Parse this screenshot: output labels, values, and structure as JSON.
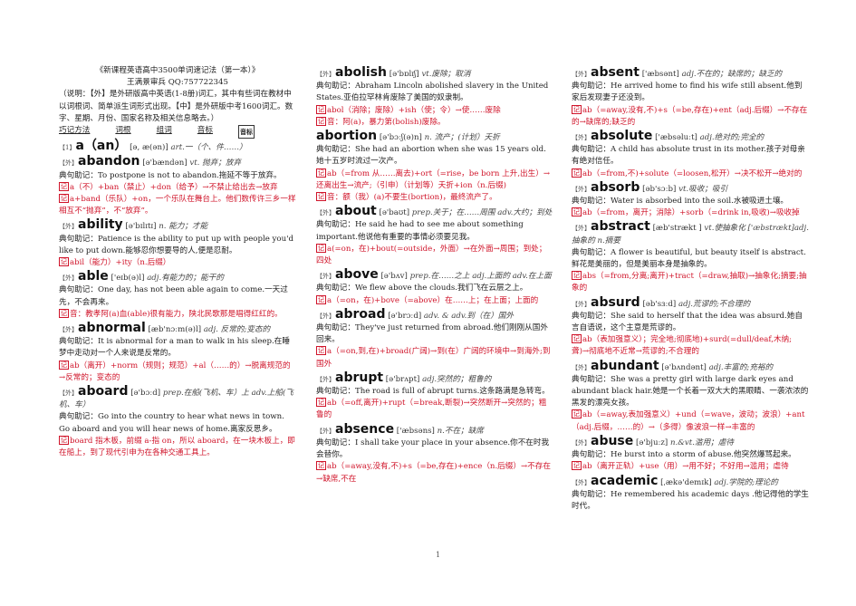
{
  "header": {
    "title": "《新课程英语高中3500单词速记法（第一本）》",
    "author": "王满景审兵 QQ:757722345",
    "note": "（说明：【外】是外研版高中英语(1-8册)词汇，其中有些词在教材中以词根词、简单派生词形式出现。【中】是外研版中考1600词汇。数字、星期、月份、国家名称及相关信息略去。）"
  },
  "legend": [
    "巧记方法",
    "词根",
    "组词",
    "音标"
  ],
  "legend_box": "音标",
  "columns": [
    {
      "entries": [
        {
          "num": "【1】",
          "word": "a（an）",
          "phon": "[ə, æ(ən)]",
          "pos": "art.一（个、件……）",
          "lines": []
        },
        {
          "num": "【外】",
          "word": "abandon",
          "phon": "[ə'bændən]",
          "pos": "vt. 抛弃；放弃",
          "lines": [
            "典句助记：To postpone is not to abandon.拖延不等于放弃。"
          ],
          "mem": [
            "a（不）+ban（禁止）+don（给予）→不禁止给出去→放弃",
            "a+band（乐队）+on，一个乐队在舞台上。他们数传许三乡一样相互不“抛弃”，不“放弃”。"
          ]
        },
        {
          "num": "【外】",
          "word": "ability",
          "phon": "[ə'bɪlɪtɪ]",
          "pos": "n. 能力；才能",
          "lines": [
            "典句助记：Patience is the ability to put up with people you'd like to put down.能够忍你想要导的人,便是忍耐。"
          ],
          "mem": [
            "abil（能力）+ity（n.后缀）"
          ]
        },
        {
          "num": "【外】",
          "word": "able",
          "phon": "['eɪb(ə)l]",
          "pos": "adj.有能力的；能干的",
          "lines": [
            "典句助记：One day, has not been able again to come.一天过先，不会再来。"
          ],
          "mem": [
            "音：教孝阿(a)血(able)很有能力，陕北民歌那是唱得红红的。"
          ]
        },
        {
          "num": "【外】",
          "word": "abnormal",
          "phon": "[æb'nɔːm(ə)l]",
          "pos": "adj. 反常的;变态的",
          "lines": [
            "典句助记：It is abnormal for a man to walk in his sleep.在睡梦中走动对一个人来说是反常的。"
          ],
          "mem": [
            "ab（离开）+norm（规则；规范）+al（……的）→脱离规范的→反常的；变态的"
          ]
        },
        {
          "num": "【外】",
          "word": "aboard",
          "phon": "[ə'bɔːd]",
          "pos": "prep.在船(飞机、车）上 adv.上船(飞机、车）",
          "lines": [
            "典句助记：Go into the country to hear what news in town. Go aboard and you will hear news of home.离家反思乡。"
          ],
          "mem": [
            "board 指木板，前缀 a-指 on，所以 aboard，在一块木板上，即在船上，到了现代引申为在各种交通工具上。"
          ]
        }
      ]
    },
    {
      "entries": [
        {
          "num": "【外】",
          "word": "abolish",
          "phon": "[ə'bɒlɪʃ]",
          "pos": "vt.废除；取消",
          "lines": [
            "典句助记：Abraham Lincoln abolished slavery in the United States.亚伯拉罕林肯废除了美国的奴隶制。"
          ],
          "mem": [
            "abol（消除；废除）+ish（使；令）→使……废除",
            "音：阿(a)，暴力第(bolish)废除。"
          ]
        },
        {
          "num": "",
          "word": "abortion",
          "phon": "[ə'bɔːʃ(ə)n]",
          "pos": "n. 流产；(计划）夭折",
          "lines": [
            "典句助记：She had an abortion when she was 15 years old.她十五岁时流过一次产。"
          ],
          "mem": [
            "ab（=from 从……离去)+ort（=rise，be born 上升,出生）→还离出生→流产;（引申）（计划等）夭折+ion（n.后缀)",
            "音：额（我）(a)不要生(bortion)，最终流产了。"
          ]
        },
        {
          "num": "【外】",
          "word": "about",
          "phon": "[ə'baʊt]",
          "pos": "prep.关于；在……周围 adv.大约；到处",
          "lines": [
            "典句助记：He said he had to see me about something important.他说他有重要的事情必须要见我。"
          ],
          "mem": [
            "a(=on，在)+bout(=outside，外面）→在外面→周围；到处；四处"
          ]
        },
        {
          "num": "【外】",
          "word": "above",
          "phon": "[ə'bʌv]",
          "pos": "prep.在……之上 adj.上面的 adv.在上面",
          "lines": [
            "典句助记：We flew above the clouds.我们飞在云层之上。"
          ],
          "mem": [
            "a（=on，在)+bove（=above）在……上；在上面；上面的"
          ]
        },
        {
          "num": "【外】",
          "word": "abroad",
          "phon": "[ə'brɔːd]",
          "pos": "adv. & adv.到（在）国外",
          "lines": [
            "典句助记：They've just returned from abroad.他们刚刚从国外回来。"
          ],
          "mem": [
            "a（=on,到,在)+broad(广阔)→到(在）广阔的环境中→到海外;到国外"
          ]
        },
        {
          "num": "【外】",
          "word": "abrupt",
          "phon": "[ə'brʌpt]",
          "pos": "adj.突然的；粗鲁的",
          "lines": [
            "典句助记：The road is full of abrupt turns.这条路满是急转弯。"
          ],
          "mem": [
            "ab（=off,离开)+rupt（=break,断裂)→突然断开→突然的；粗鲁的"
          ]
        },
        {
          "num": "【外】",
          "word": "absence",
          "phon": "['æbsəns]",
          "pos": "n.不在；缺席",
          "lines": [
            "典句助记：I shall take your place in your absence.你不在时我会替你。"
          ],
          "mem": [
            "ab（=away,没有,不)+s（=be,存在)+ence（n.后缀）→不存在→缺席,不在"
          ]
        }
      ]
    },
    {
      "entries": [
        {
          "num": "【外】",
          "word": "absent",
          "phon": "['æbsənt]",
          "pos": "adj.不在的；缺席的；缺乏的",
          "lines": [
            "典句助记：He arrived home to find his wife still absent.他到家后发现妻子还没到。"
          ],
          "mem": [
            "ab（=away,没有,不)+s（=be,存在)+ent（adj.后缀）→不存在的→缺席的;缺乏的"
          ]
        },
        {
          "num": "【外】",
          "word": "absolute",
          "phon": "['æbsəluːt]",
          "pos": "adj.绝对的;完全的",
          "lines": [
            "典句助记：A child has absolute trust in its mother.孩子对母亲有绝对信任。"
          ],
          "mem": [
            "ab（=from,不)+solute（=loosen,松开）→决不松开→绝对的"
          ]
        },
        {
          "num": "【外】",
          "word": "absorb",
          "phon": "[əb'sɔːb]",
          "pos": "vt.吸收；吸引",
          "lines": [
            "典句助记：Water is absorbed into the soil.水被吸进土壤。"
          ],
          "mem": [
            "ab（=from，离开；消除）+sorb（=drink in,吸收)→吸收掉"
          ]
        },
        {
          "num": "【外】",
          "word": "abstract",
          "phon": "[æb'strækt ]",
          "pos": "vt.使抽象化 ['æbstrækt]adj.抽象的 n.摘要",
          "lines": [
            "典句助记：A flower is beautiful, but beauty itself is abstract.鲜花是美丽的，但是美丽本身是抽象的。"
          ],
          "mem": [
            "abs（=from,分离;离开)+tract（=draw,抽取)→抽象化;摘要;抽象的"
          ]
        },
        {
          "num": "【外】",
          "word": "absurd",
          "phon": "[əb'sɜːd]",
          "pos": "adj.荒谬的;不合理的",
          "lines": [
            "典句助记：She said to herself that the idea was absurd.她自言自语说，这个主意是荒谬的。"
          ],
          "mem": [
            "ab（表加强意义）；完全地;彻底地)+surd(=dull/deaf,木纳;聋)→彻底地不近常→荒谬的;不合理的"
          ]
        },
        {
          "num": "【外】",
          "word": "abundant",
          "phon": "[ə'bʌndənt]",
          "pos": "adj.丰富的;充裕的",
          "lines": [
            "典句助记：She was a pretty girl with large dark eyes and abundant black hair.她是一个长着一双大大的黑眼睛、一袭浓浓的黑发的漂亮女孩。"
          ],
          "mem": [
            "ab（=away,表加强意义）+und（=wave，波动；波浪）+ant（adj.后缀，……的）→（多得）像波浪一样→丰富的"
          ]
        },
        {
          "num": "【外】",
          "word": "abuse",
          "phon": "[ə'bjuːz]",
          "pos": "n.&vt.滥用；虐待",
          "lines": [
            "典句助记：He burst into a storm of abuse.他突然爆骂起来。"
          ],
          "mem": [
            "ab（离开正轨）+use（用）→用不好；不好用→滥用；虐待"
          ]
        },
        {
          "num": "【外】",
          "word": "academic",
          "phon": "[ˌækə'demɪk]",
          "pos": "adj.学院的;理论的",
          "lines": [
            "典句助记：He remembered his academic days .他记得他的学生时代。"
          ],
          "mem": []
        }
      ]
    }
  ],
  "page_number": "1"
}
